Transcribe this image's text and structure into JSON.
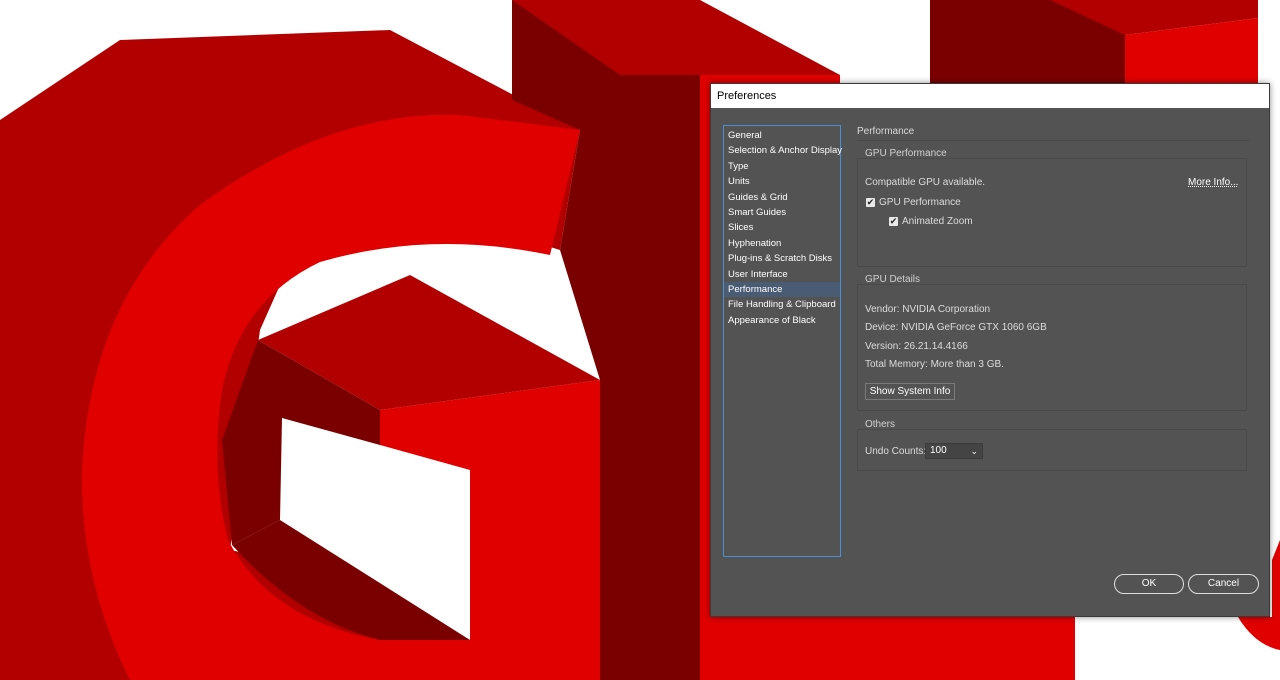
{
  "background": {
    "colors": {
      "bright": "#e00000",
      "mid": "#b20000",
      "dark": "#7a0000",
      "white": "#ffffff"
    }
  },
  "dialog": {
    "title": "Preferences",
    "categories": [
      {
        "label": "General",
        "selected": false
      },
      {
        "label": "Selection & Anchor Display",
        "selected": false
      },
      {
        "label": "Type",
        "selected": false
      },
      {
        "label": "Units",
        "selected": false
      },
      {
        "label": "Guides & Grid",
        "selected": false
      },
      {
        "label": "Smart Guides",
        "selected": false
      },
      {
        "label": "Slices",
        "selected": false
      },
      {
        "label": "Hyphenation",
        "selected": false
      },
      {
        "label": "Plug-ins & Scratch Disks",
        "selected": false
      },
      {
        "label": "User Interface",
        "selected": false
      },
      {
        "label": "Performance",
        "selected": true
      },
      {
        "label": "File Handling & Clipboard",
        "selected": false
      },
      {
        "label": "Appearance of Black",
        "selected": false
      }
    ],
    "page_title": "Performance",
    "gpu_performance": {
      "title": "GPU Performance",
      "status": "Compatible GPU available.",
      "more_info": "More Info...",
      "gpu_checkbox": {
        "label": "GPU Performance",
        "checked": true
      },
      "zoom_checkbox": {
        "label": "Animated Zoom",
        "checked": true
      }
    },
    "gpu_details": {
      "title": "GPU Details",
      "vendor": "Vendor: NVIDIA Corporation",
      "device": "Device: NVIDIA GeForce GTX 1060 6GB",
      "version": "Version: 26.21.14.4166",
      "memory": "Total Memory:  More than 3 GB.",
      "system_info_button": "Show System Info"
    },
    "others": {
      "title": "Others",
      "undo_label": "Undo Counts:",
      "undo_value": "100"
    },
    "ok_label": "OK",
    "cancel_label": "Cancel"
  }
}
